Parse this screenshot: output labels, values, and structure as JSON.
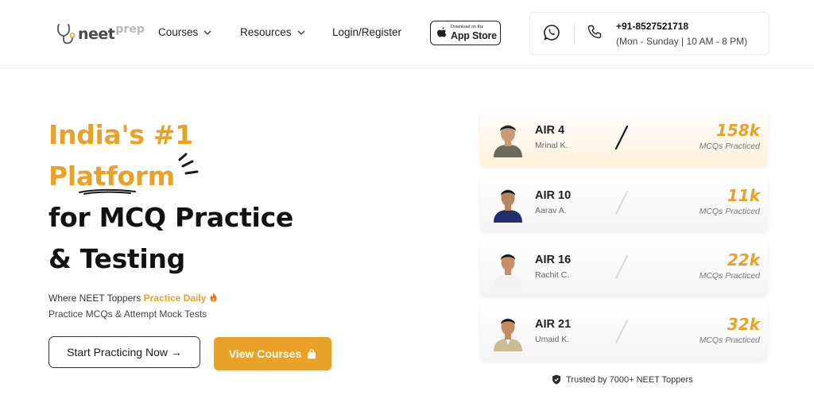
{
  "header": {
    "logo": {
      "main": "neet",
      "accent": "prep"
    },
    "nav": [
      {
        "label": "Courses",
        "has_dropdown": true
      },
      {
        "label": "Resources",
        "has_dropdown": true
      },
      {
        "label": "Login/Register",
        "has_dropdown": false
      }
    ],
    "appstore": {
      "small": "Download on the",
      "big": "App Store"
    },
    "contact": {
      "phone": "+91-8527521718",
      "hours": "(Mon - Sunday | 10 AM - 8 PM)",
      "icons": [
        "whatsapp-icon",
        "phone-icon"
      ]
    }
  },
  "hero": {
    "line1": "India's #1",
    "line2": "Platform",
    "line3": "for MCQ Practice",
    "line4": "& Testing",
    "sub_prefix": "Where NEET Toppers ",
    "sub_highlight": "Practice Daily",
    "sub2": "Practice MCQs & Attempt Mock Tests",
    "primary_button": "Start Practicing Now →",
    "secondary_button": "View Courses",
    "accent_color": "#e9a227"
  },
  "toppers": [
    {
      "rank": "AIR 4",
      "name": "Mrinal K.",
      "count": "158k",
      "caption": "MCQs Practiced"
    },
    {
      "rank": "AIR 10",
      "name": "Aarav A.",
      "count": "11k",
      "caption": "MCQs Practiced"
    },
    {
      "rank": "AIR 16",
      "name": "Rachit C.",
      "count": "22k",
      "caption": "MCQs Practiced"
    },
    {
      "rank": "AIR 21",
      "name": "Umaid K.",
      "count": "32k",
      "caption": "MCQs Practiced"
    }
  ],
  "trusted": "Trusted by 7000+ NEET Toppers"
}
